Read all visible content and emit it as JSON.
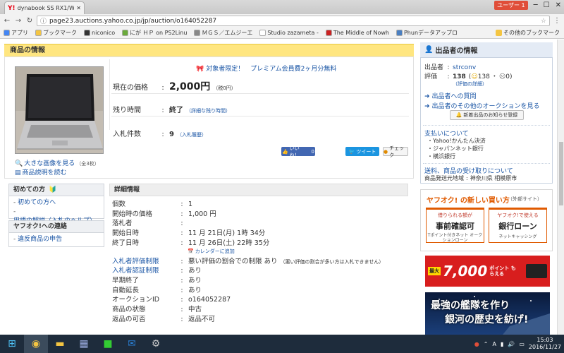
{
  "browser": {
    "tab_title": "dynabook SS RX1/W7",
    "url": "page23.auctions.yahoo.co.jp/jp/auction/o164052287",
    "profile": "ユーザー 1",
    "bookmarks": [
      {
        "label": "アプリ",
        "color": "#4285f4"
      },
      {
        "label": "ブックマーク",
        "color": "#f4c542"
      },
      {
        "label": "niconico",
        "color": "#333333"
      },
      {
        "label": "にが ＨＰ on PS2Linu",
        "color": "#6aaa3a"
      },
      {
        "label": "ＭＧＳ／エムジーエ",
        "color": "#888888"
      },
      {
        "label": "Studio zazameta - ",
        "color": "#ffffff"
      },
      {
        "label": "The Middle of Nowh",
        "color": "#cc2222"
      },
      {
        "label": "Phunデータアップロ",
        "color": "#4a7fc1"
      }
    ],
    "bookmarks_other": "その他のブックマーク"
  },
  "product": {
    "section_title": "商品の情報",
    "promo": "対象者限定！　プレミアム会員費2ヶ月分無料",
    "price_label": "現在の価格",
    "price": "2,000円",
    "price_tax": "（税0円）",
    "remaining_label": "残り時間",
    "remaining": "終了",
    "remaining_detail": "（詳細な残り時間）",
    "bids_label": "入札件数",
    "bids": "9",
    "bids_history": "（入札履歴）",
    "enlarge": "大きな画像を見る",
    "enlarge_count": "（全3枚）",
    "read_desc": "商品説明を読む",
    "like": "いいね！",
    "like_count": "0",
    "tweet": "ツイート",
    "check": "チェック"
  },
  "sidebar": {
    "beginner_title": "初めての方",
    "beginner_links": [
      "初めての方へ",
      "用語の解説（入札のヘルプ）"
    ],
    "contact_title": "ヤフオク!への連絡",
    "contact_links": [
      "違反商品の申告"
    ]
  },
  "details": {
    "title": "詳細情報",
    "rows": [
      {
        "k": "個数",
        "v": "1"
      },
      {
        "k": "開始時の価格",
        "v": "1,000 円"
      },
      {
        "k": "落札者",
        "v": ""
      },
      {
        "k": "開始日時",
        "v": "11 月 21日(月) 1時 34分"
      },
      {
        "k": "終了日時",
        "v": "11 月 26日(土) 22時 35分"
      },
      {
        "k": "入札者評価制限",
        "v": "悪い評価の割合での制限 あり",
        "note": "（悪い評価の割合が多い方は入札できません）"
      },
      {
        "k": "入札者認証制限",
        "v": "あり"
      },
      {
        "k": "早期終了",
        "v": "あり"
      },
      {
        "k": "自動延長",
        "v": "あり"
      },
      {
        "k": "オークションID",
        "v": "o164052287"
      },
      {
        "k": "商品の状態",
        "v": "中古"
      },
      {
        "k": "返品の可否",
        "v": "返品不可"
      }
    ],
    "calendar": "カレンダーに追加"
  },
  "seller": {
    "title": "出品者の情報",
    "name_label": "出品者",
    "name": "strconv",
    "rating_label": "評価",
    "rating": "138",
    "rating_good": "138",
    "rating_bad": "0",
    "rating_detail": "（評価の詳細）",
    "ask": "出品者への質問",
    "other_auctions": "出品者のその他のオークションを見る",
    "register": "新着出品のお知らせ登録",
    "payment_title": "支払いについて",
    "payments": [
      "Yahoo!かんたん決済",
      "ジャパンネット銀行",
      "横浜銀行"
    ],
    "shipping_title": "送料、商品の受け取りについて",
    "shipping_label": "商品発送元地域",
    "shipping_area": "神奈川県 相模原市"
  },
  "ads": {
    "title": "ヤフオク! の新しい買い方",
    "external": "（外部サイト）",
    "ad1_top": "借りられる額が",
    "ad1_main": "事前確認可",
    "ad1_sub": "Tポイント付きネット オークションローン",
    "ad2_top": "ヤフオク!で使える",
    "ad2_main": "銀行ローン",
    "ad2_sub": "ネットキャッシング",
    "banner_max": "最大",
    "banner_points": "7,000",
    "banner_unit": "ポイント もらえる",
    "game_line1": "最強の艦隊を作り",
    "game_line2": "銀河の歴史を紡げ!"
  },
  "taskbar": {
    "time": "15:03",
    "date": "2016/11/27",
    "ime": "A"
  }
}
